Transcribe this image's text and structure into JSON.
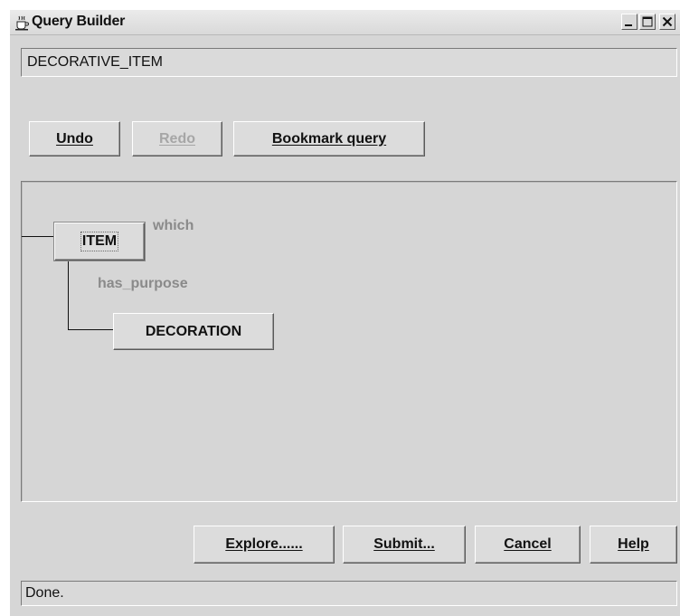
{
  "window": {
    "title": "Query Builder",
    "icon": "java-cup-icon",
    "controls": [
      "minimize-icon",
      "maximize-icon",
      "close-icon"
    ]
  },
  "query_field": {
    "value": "DECORATIVE_ITEM"
  },
  "toolbar": {
    "undo_label": "Undo",
    "redo_label": "Redo",
    "bookmark_label": "Bookmark query"
  },
  "graph": {
    "nodes": [
      {
        "id": "item",
        "label": "ITEM",
        "selected": true
      },
      {
        "id": "decoration",
        "label": "DECORATION",
        "selected": false
      }
    ],
    "edges": [
      {
        "label": "which"
      },
      {
        "label": "has_purpose"
      }
    ]
  },
  "actions": {
    "explore_label": "Explore......",
    "submit_label": "Submit...",
    "cancel_label": "Cancel",
    "help_label": "Help"
  },
  "status": {
    "text": "Done."
  },
  "colors": {
    "background": "#d6d6d6",
    "disabled_text": "#a6a6a6",
    "edge_label_text": "#8a8a8a"
  }
}
